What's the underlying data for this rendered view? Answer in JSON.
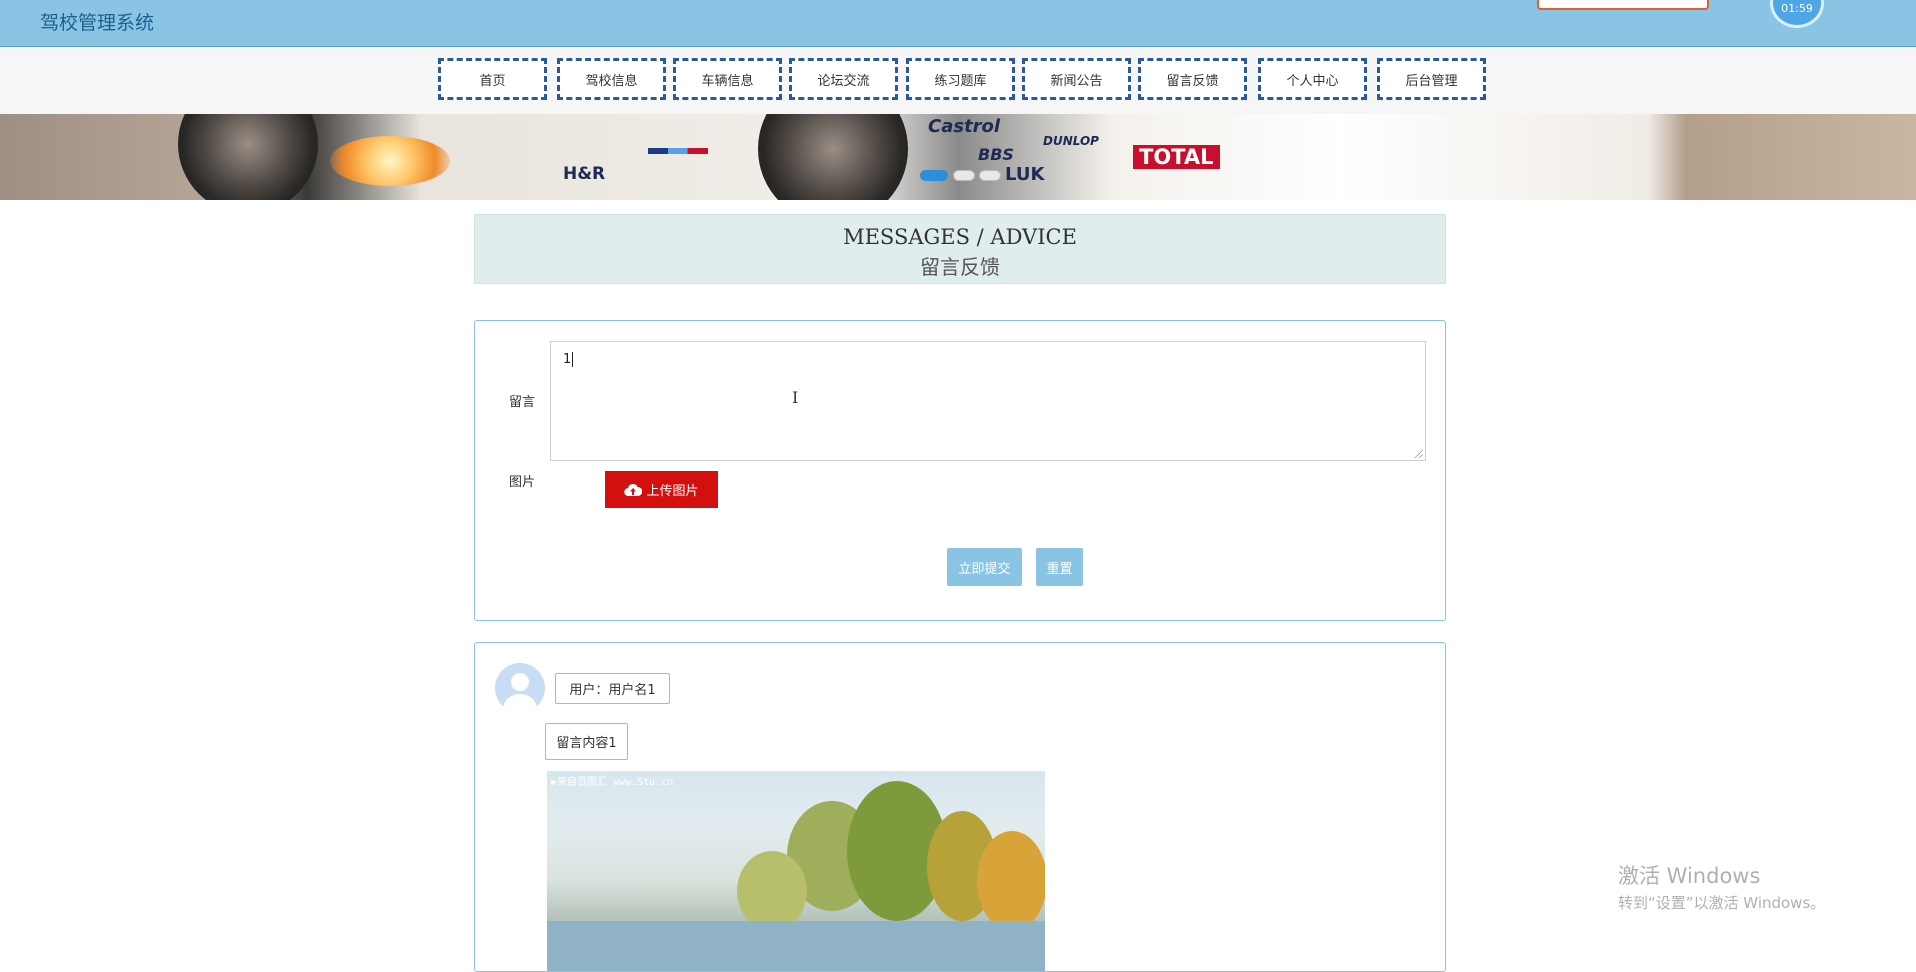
{
  "app": {
    "title": "驾校管理系统",
    "timer_text": "01:59"
  },
  "nav": {
    "items": [
      {
        "label": "首页"
      },
      {
        "label": "驾校信息"
      },
      {
        "label": "车辆信息"
      },
      {
        "label": "论坛交流"
      },
      {
        "label": "练习题库"
      },
      {
        "label": "新闻公告"
      },
      {
        "label": "留言反馈"
      },
      {
        "label": "个人中心"
      },
      {
        "label": "后台管理"
      }
    ]
  },
  "banner": {
    "decals": [
      "H&R",
      "Castrol",
      "BBS",
      "DUNLOP",
      "LUK",
      "TOTAL"
    ],
    "slides": 3,
    "active_slide": 1
  },
  "section": {
    "title_en": "MESSAGES / ADVICE",
    "title_cn": "留言反馈"
  },
  "form": {
    "message_label": "留言",
    "message_value": "1",
    "image_label": "图片",
    "upload_label": "上传图片",
    "submit_label": "立即提交",
    "reset_label": "重置"
  },
  "messages": [
    {
      "user": "用户：用户名1",
      "content": "留言内容1",
      "image_watermark": "▶来自百图汇 www.5tu.cn"
    }
  ],
  "windows_activation": {
    "title": "激活 Windows",
    "subtitle": "转到“设置”以激活 Windows。"
  },
  "colors": {
    "header_bg": "#89c4e4",
    "nav_border": "#2b5a9c",
    "upload_btn": "#d40f0f",
    "form_buttons": "#89c4e4",
    "heading_bg": "#e0eded",
    "active_dot": "#2a8fd8"
  },
  "icons": [
    "cloud-upload-icon",
    "user-avatar-icon",
    "text-cursor-icon"
  ]
}
